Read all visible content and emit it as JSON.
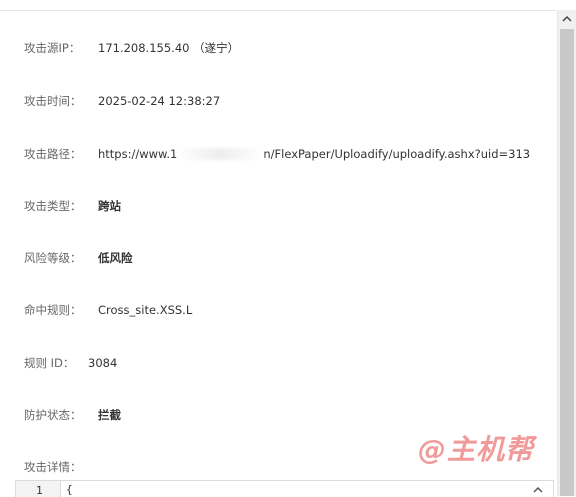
{
  "fields": {
    "source_ip": {
      "label": "攻击源IP：",
      "value": "171.208.155.40 （遂宁）"
    },
    "attack_time": {
      "label": "攻击时间：",
      "value": "2025-02-24 12:38:27"
    },
    "attack_path": {
      "label": "攻击路径：",
      "value_prefix": "https://www.1",
      "value_suffix": "n/FlexPaper/Uploadify/uploadify.ashx?uid=313"
    },
    "attack_type": {
      "label": "攻击类型：",
      "value": "跨站"
    },
    "risk_level": {
      "label": "风险等级：",
      "value": "低风险"
    },
    "hit_rule": {
      "label": "命中规则：",
      "value": "Cross_site.XSS.L"
    },
    "rule_id": {
      "label": "规则 ID：",
      "value": "3084"
    },
    "protection_status": {
      "label": "防护状态：",
      "value": "拦截"
    },
    "attack_detail": {
      "label": "攻击详情："
    }
  },
  "editor": {
    "line_number": "1",
    "first_line": "{"
  },
  "watermark": "@主机帮",
  "icons": {
    "scroll_up": "chevron-up-icon",
    "editor_scroll_up": "chevron-up-icon"
  },
  "colors": {
    "label": "#666666",
    "value": "#333333",
    "watermark": "#ec7878",
    "scrollbar_thumb": "#c8c8c8"
  }
}
